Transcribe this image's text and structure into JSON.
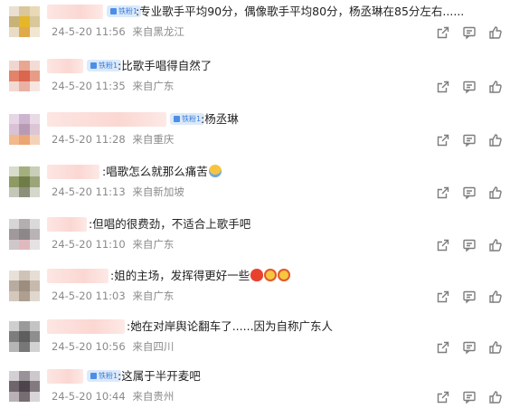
{
  "badge_label": "铁粉1",
  "comments": [
    {
      "text": ":专业歌手平均90分，偶像歌手平均80分，杨丞琳在85分左右......",
      "date": "24-5-20",
      "time": "11:56",
      "location": "来自黑龙江",
      "has_badge": true
    },
    {
      "text": ":比歌手唱得自然了",
      "date": "24-5-20",
      "time": "11:35",
      "location": "来自广东",
      "has_badge": true
    },
    {
      "text": ":杨丞琳",
      "date": "24-5-20",
      "time": "11:28",
      "location": "来自重庆",
      "has_badge": true
    },
    {
      "text": ":唱歌怎么就那么痛苦",
      "date": "24-5-20",
      "time": "11:13",
      "location": "来自新加坡",
      "has_badge": false,
      "emoji": "sweat-smile"
    },
    {
      "text": ":但唱的很费劲，不适合上歌手吧",
      "date": "24-5-20",
      "time": "11:10",
      "location": "来自广东",
      "has_badge": false
    },
    {
      "text": ":姐的主场，发挥得更好一些",
      "date": "24-5-20",
      "time": "11:03",
      "location": "来自广东",
      "has_badge": false,
      "emoji": "heart-and-faces"
    },
    {
      "text": ":她在对岸舆论翻车了......因为自称广东人",
      "date": "24-5-20",
      "time": "10:56",
      "location": "来自四川",
      "has_badge": false
    },
    {
      "text": ":这属于半开麦吧",
      "date": "24-5-20",
      "time": "10:44",
      "location": "来自贵州",
      "has_badge": true
    }
  ],
  "actions": [
    "share-icon",
    "comment-icon",
    "like-icon"
  ],
  "colors": {
    "text": "#222222",
    "meta": "#8a8a8a",
    "badge_bg": "#dbe9fb",
    "badge_text": "#3d7fd8",
    "icon": "#7d7d7d"
  }
}
